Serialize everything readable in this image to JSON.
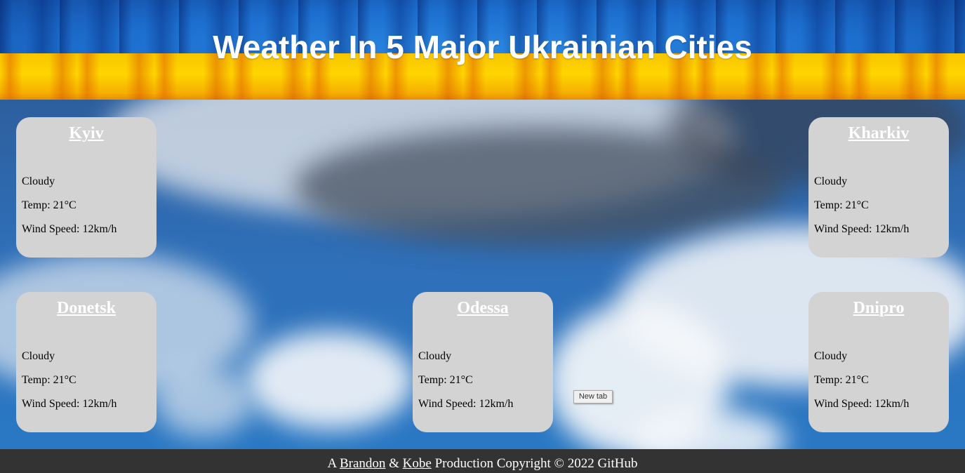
{
  "header": {
    "title": "Weather In 5 Major Ukrainian Cities"
  },
  "colors": {
    "flag_blue": "#1d6fcf",
    "flag_yellow": "#ffd500",
    "card_bg": "#d3d3d3",
    "footer_bg": "#333333"
  },
  "cities": [
    {
      "name": "Kyiv",
      "condition": "Cloudy",
      "temp": "Temp: 21°C",
      "wind": "Wind Speed: 12km/h"
    },
    {
      "name": "Kharkiv",
      "condition": "Cloudy",
      "temp": "Temp: 21°C",
      "wind": "Wind Speed: 12km/h"
    },
    {
      "name": "Donetsk",
      "condition": "Cloudy",
      "temp": "Temp: 21°C",
      "wind": "Wind Speed: 12km/h"
    },
    {
      "name": "Odessa",
      "condition": "Cloudy",
      "temp": "Temp: 21°C",
      "wind": "Wind Speed: 12km/h"
    },
    {
      "name": "Dnipro",
      "condition": "Cloudy",
      "temp": "Temp: 21°C",
      "wind": "Wind Speed: 12km/h"
    }
  ],
  "tooltip": {
    "text": "New tab"
  },
  "footer": {
    "prefix": "A",
    "author1": "Brandon",
    "amp": "&",
    "author2": "Kobe",
    "suffix": "Production Copyright © 2022 GitHub"
  }
}
